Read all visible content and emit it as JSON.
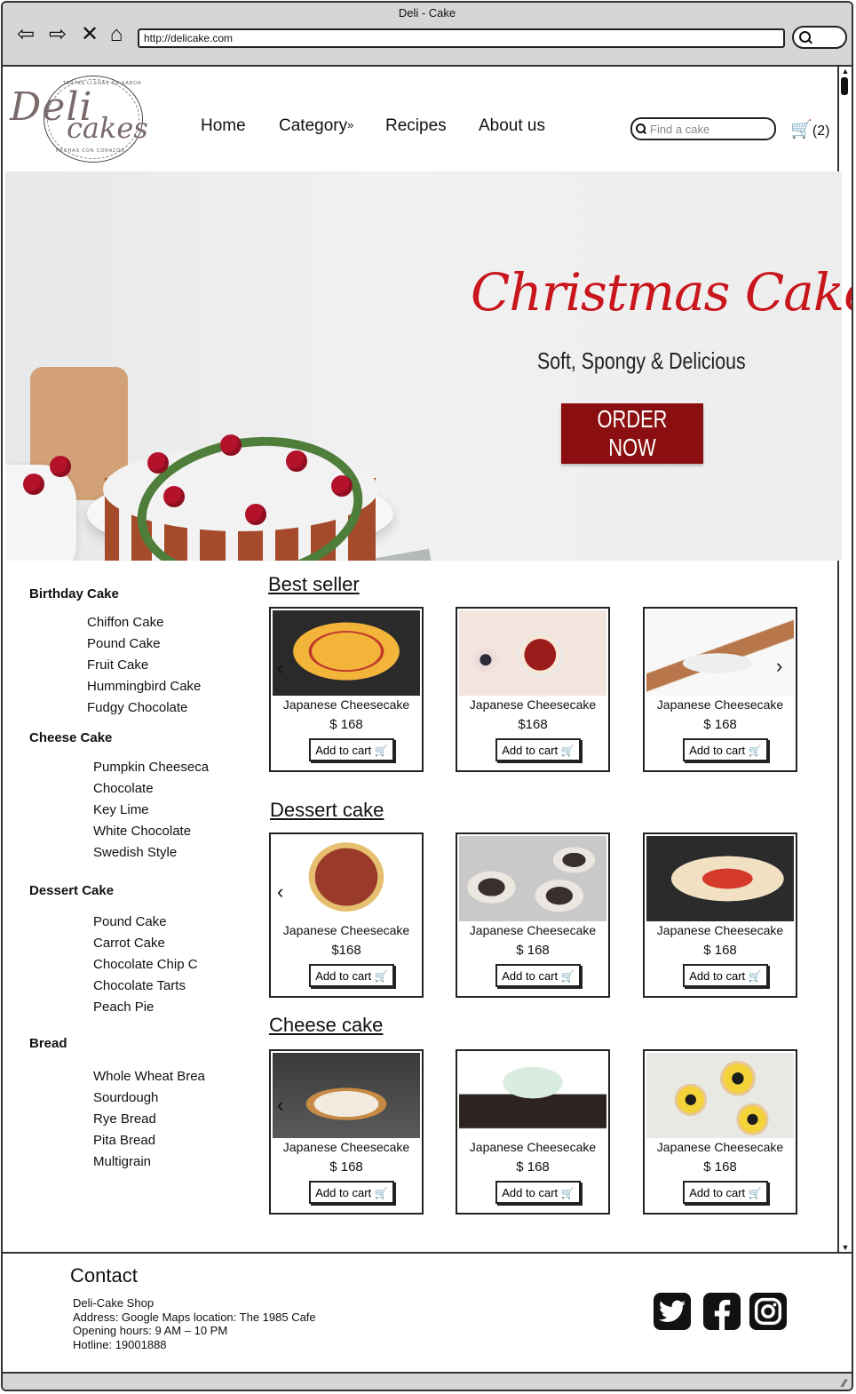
{
  "window": {
    "title": "Deli - Cake",
    "url": "http://delicake.com"
  },
  "logo": {
    "line1": "Deli",
    "line2": "cakes",
    "ring_top": "TARTAS LLENAS DE SABOR",
    "ring_bottom": "HECHAS CON CORAZÓN"
  },
  "nav": {
    "items": [
      "Home",
      "Category",
      "Recipes",
      "About us"
    ],
    "category_chevron": "»"
  },
  "search": {
    "placeholder": "Find a cake"
  },
  "cart": {
    "count": "(2)"
  },
  "hero": {
    "title": "Christmas Cakes",
    "subtitle": "Soft, Spongy & Delicious",
    "button": "ORDER NOW"
  },
  "sidebar": {
    "groups": [
      {
        "label": "Birthday Cake",
        "items": [
          "Chiffon Cake",
          "Pound Cake",
          "Fruit Cake",
          "Hummingbird Cake",
          "Fudgy Chocolate"
        ]
      },
      {
        "label": "Cheese Cake",
        "items": [
          "Pumpkin Cheeseca",
          "Chocolate",
          "Key Lime",
          "White Chocolate",
          "Swedish Style"
        ]
      },
      {
        "label": "Dessert Cake",
        "items": [
          "Pound Cake",
          "Carrot Cake",
          "Chocolate Chip C",
          "Chocolate Tarts",
          "Peach Pie"
        ]
      },
      {
        "label": "Bread",
        "items": [
          "Whole Wheat Brea",
          "Sourdough",
          "Rye Bread",
          "Pita Bread",
          "Multigrain"
        ]
      }
    ]
  },
  "sections": [
    {
      "title": "Best seller",
      "cards": [
        {
          "name": "Japanese Cheesecake",
          "price": "$ 168",
          "button": "Add to cart"
        },
        {
          "name": "Japanese Cheesecake",
          "price": "$168",
          "button": "Add to cart"
        },
        {
          "name": "Japanese Cheesecake",
          "price": "$ 168",
          "button": "Add to cart"
        }
      ]
    },
    {
      "title": "Dessert cake",
      "cards": [
        {
          "name": "Japanese Cheesecake",
          "price": "$168",
          "button": "Add to cart"
        },
        {
          "name": "Japanese Cheesecake",
          "price": "$ 168",
          "button": "Add to cart"
        },
        {
          "name": "Japanese Cheesecake",
          "price": "$ 168",
          "button": "Add to cart"
        }
      ]
    },
    {
      "title": "Cheese cake",
      "cards": [
        {
          "name": "Japanese Cheesecake",
          "price": "$ 168",
          "button": "Add to cart"
        },
        {
          "name": "Japanese Cheesecake",
          "price": "$ 168",
          "button": "Add to cart"
        },
        {
          "name": "Japanese Cheesecake",
          "price": "$ 168",
          "button": "Add to cart"
        }
      ]
    }
  ],
  "footer": {
    "title": "Contact",
    "lines": [
      "Deli-Cake Shop",
      "Address: Google Maps location: The 1985 Cafe",
      "Opening hours: 9 AM – 10 PM",
      "Hotline: 19001888"
    ]
  },
  "colors": {
    "accent": "#c8161c",
    "button": "#8b0f10",
    "chrome": "#d6d6d6"
  },
  "icons": [
    "back-icon",
    "forward-icon",
    "close-icon",
    "home-icon",
    "search-icon",
    "cart-icon",
    "twitter-icon",
    "facebook-icon",
    "instagram-icon"
  ]
}
